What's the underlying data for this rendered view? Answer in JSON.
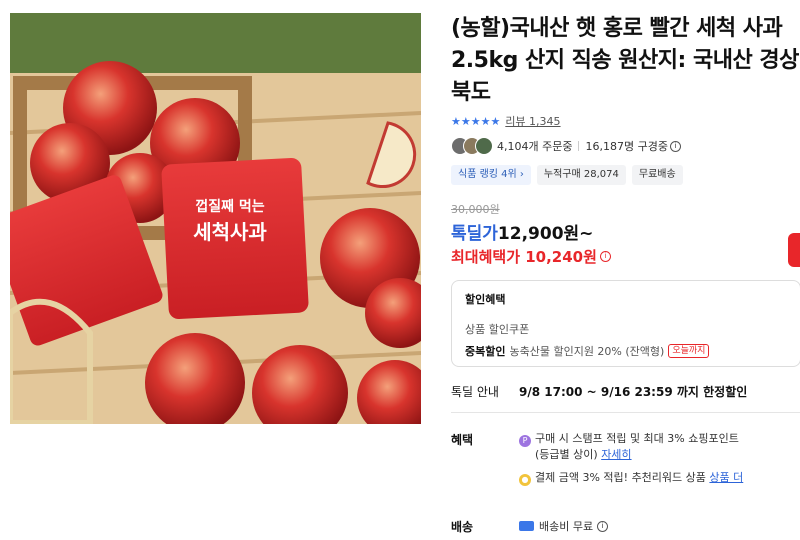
{
  "product": {
    "title": "(농할)국내산 햇 홍로 빨간 세척 사과 2.5kg 산지 직송 원산지: 국내산 경상북도",
    "stars": "★★★★★",
    "review_label": "리뷰 1,345",
    "orders": "4,104개 주문중",
    "subscribers": "16,187명 구경중",
    "badges": [
      {
        "label": "식품 랭킹 4위 ›"
      },
      {
        "label": "누적구매 28,074"
      },
      {
        "label": "무료배송"
      }
    ]
  },
  "price": {
    "original": "30,000원",
    "deal_label": "톡딜가",
    "deal_price": "12,900원~",
    "max_benefit": "최대혜택가 10,240원"
  },
  "discount": {
    "header": "할인혜택",
    "line1": "상품 할인쿠폰",
    "line2_bold": "중복할인",
    "line2": "농축산물 할인지원 20% (잔액형)",
    "today_badge": "오늘까지"
  },
  "deal_period": {
    "label": "톡딜 안내",
    "value": "9/8 17:00 ~ 9/16 23:59 까지 한정할인"
  },
  "benefits": {
    "label": "혜택",
    "line1": "구매 시 스탬프 적립 및 최대 3% 쇼핑포인트",
    "line1b": "(등급별 상이)",
    "line1_link": "자세히",
    "line2": "결제 금액 3% 적립! 추천리워드 상품",
    "line2_link": "상품 더"
  },
  "shipping": {
    "label": "배송",
    "value": "배송비 무료"
  },
  "image_text": {
    "bag_line1": "껍질째 먹는",
    "bag_line2": "세척사과"
  },
  "colors": {
    "accent_blue": "#2d64d8",
    "accent_red": "#e8262a"
  }
}
